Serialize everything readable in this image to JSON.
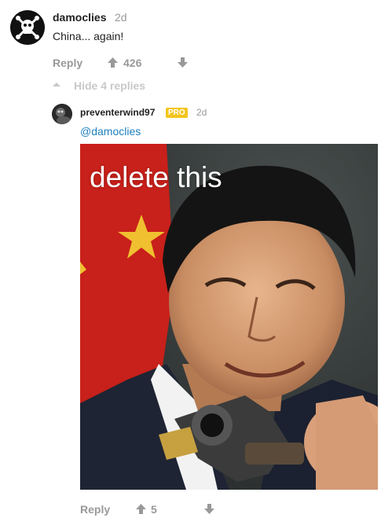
{
  "comment": {
    "username": "damoclies",
    "time": "2d",
    "text": "China... again!",
    "actions": {
      "reply_label": "Reply",
      "upvotes": "426"
    }
  },
  "replies_toggle": {
    "label": "Hide 4 replies"
  },
  "reply": {
    "username": "preventerwind97",
    "badge": "PRO",
    "time": "2d",
    "mention": "@damoclies",
    "image": {
      "caption": "delete this"
    },
    "actions": {
      "reply_label": "Reply",
      "upvotes": "5"
    }
  },
  "colors": {
    "muted": "#999999",
    "link": "#1e7fbf",
    "pro_badge": "#f4c51c"
  },
  "icons": [
    "skull-crossbones-avatar-icon",
    "up-arrow-icon",
    "down-arrow-icon",
    "caret-up-icon"
  ]
}
